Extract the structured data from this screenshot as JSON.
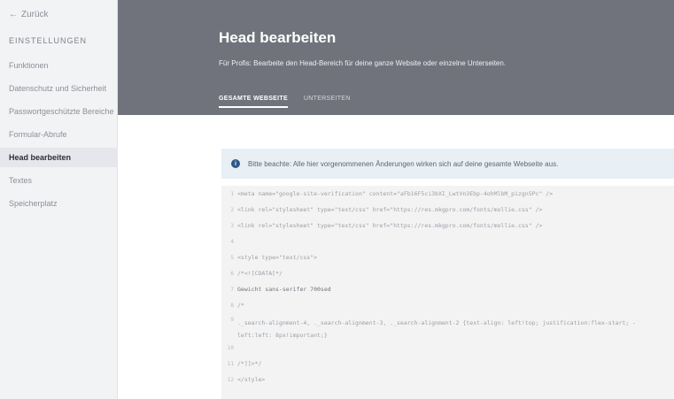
{
  "sidebar": {
    "back_label": "Zurück",
    "section_title": "EINSTELLUNGEN",
    "items": [
      {
        "label": "Funktionen",
        "active": false
      },
      {
        "label": "Datenschutz und Sicherheit",
        "active": false
      },
      {
        "label": "Passwortgeschützte Bereiche",
        "active": false
      },
      {
        "label": "Formular-Abrufe",
        "active": false
      },
      {
        "label": "Head bearbeiten",
        "active": true
      },
      {
        "label": "Textes",
        "active": false
      },
      {
        "label": "Speicherplatz",
        "active": false
      }
    ]
  },
  "header": {
    "title": "Head bearbeiten",
    "subtitle": "Für Profis: Bearbeite den Head-Bereich für deine ganze Website oder einzelne Unterseiten.",
    "tabs": [
      {
        "label": "GESAMTE WEBSEITE",
        "active": true
      },
      {
        "label": "UNTERSEITEN",
        "active": false
      }
    ]
  },
  "info": {
    "text": "Bitte beachte: Alle hier vorgenommenen Änderungen wirken sich auf deine gesamte Webseite aus."
  },
  "editor": {
    "lines": [
      {
        "n": "1",
        "text": "<meta name=\"google-site-verification\" content=\"aFb16F5ci3bXI_LwtVn3Ebp-4ohMlbM_pizgn5Pc\" />"
      },
      {
        "n": "2",
        "text": "<link rel=\"stylesheet\" type=\"text/css\" href=\"https://res.mkgpro.com/fonts/mollie.css\" />"
      },
      {
        "n": "3",
        "text": "<link rel=\"stylesheet\" type=\"text/css\" href=\"https://res.mkgpro.com/fonts/mollie.css\" />"
      },
      {
        "n": "4",
        "text": ""
      },
      {
        "n": "5",
        "text": "<style type=\"text/css\">"
      },
      {
        "n": "6",
        "text": "/*<![CDATA[*/"
      },
      {
        "n": "7",
        "text": "Gewicht sans-serifer 700sed"
      },
      {
        "n": "8",
        "text": "/*"
      },
      {
        "n": "9",
        "text": "._search-alignment-4, ._search-alignment-3, ._search-alignment-2 {text-align: left!top; justification:flex-start; -left:left: 8px!important;}",
        "wrap": true
      },
      {
        "n": "10",
        "text": ""
      },
      {
        "n": "11",
        "text": "/*]]>*/"
      },
      {
        "n": "12",
        "text": "</style>"
      }
    ]
  }
}
